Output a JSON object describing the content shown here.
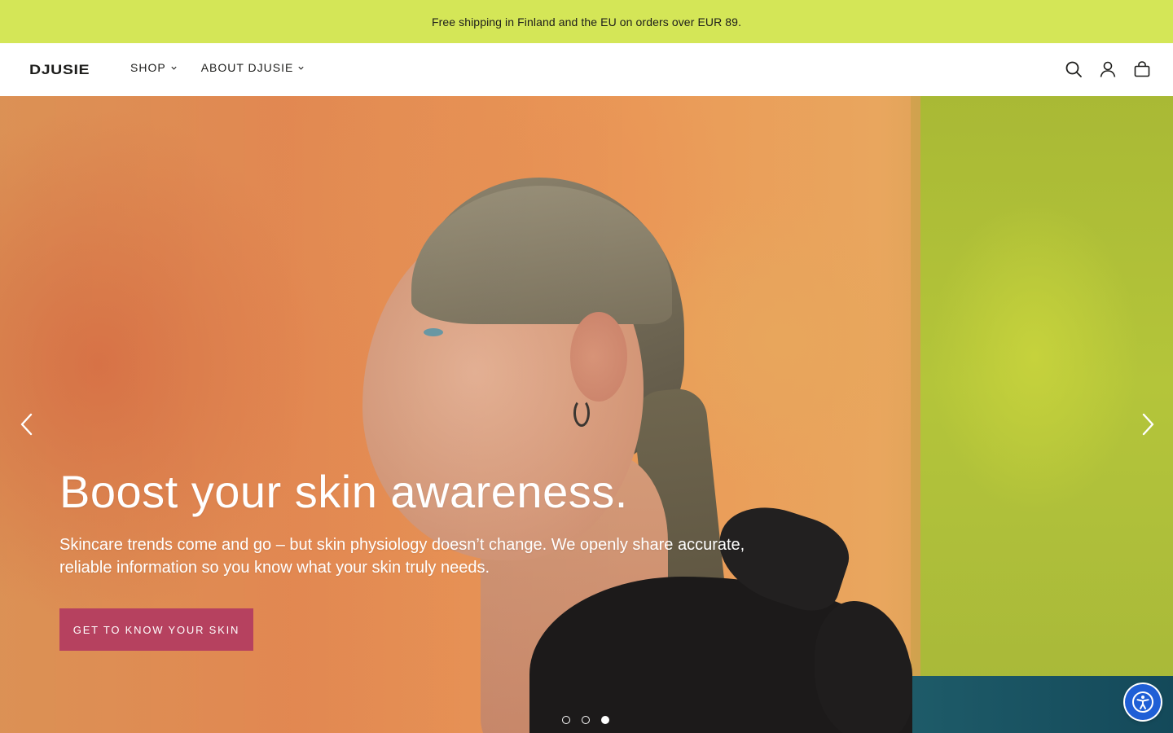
{
  "announcement": {
    "text": "Free shipping in Finland and the EU on orders over EUR 89."
  },
  "header": {
    "logo": "DJUSIE",
    "nav": [
      {
        "label": "SHOP",
        "has_dropdown": true
      },
      {
        "label": "ABOUT DJUSIE",
        "has_dropdown": true
      }
    ],
    "icons": [
      "search-icon",
      "account-icon",
      "cart-icon"
    ]
  },
  "hero": {
    "title": "Boost your skin awareness.",
    "text": "Skincare trends come and go – but skin physiology doesn’t change. We openly share accurate, reliable information so you know what your skin truly needs.",
    "cta_label": "GET TO KNOW YOUR SKIN",
    "cta_color": "#b6415f",
    "slides_total": 3,
    "active_slide": 3
  },
  "colors": {
    "announcement_bg": "#d4e657",
    "accessibility_button": "#1f5fd6"
  },
  "accessibility": {
    "icon": "accessibility-icon"
  }
}
